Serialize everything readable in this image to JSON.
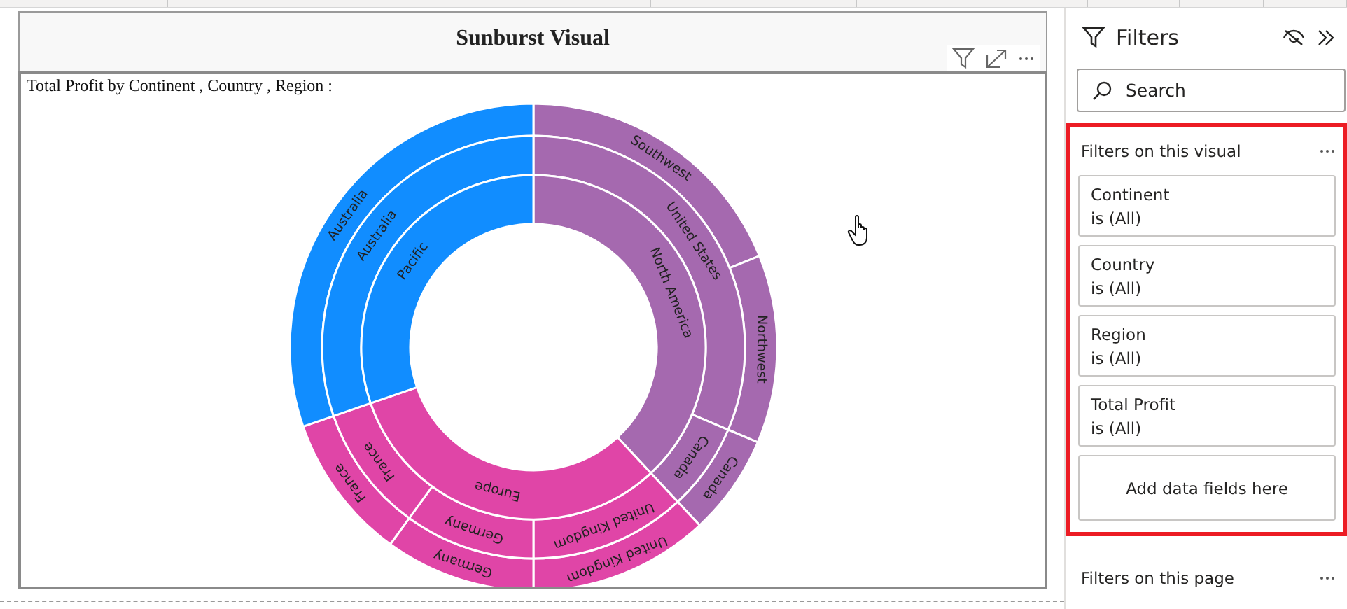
{
  "visual": {
    "title": "Sunburst Visual",
    "subtitle": "Total Profit by Continent , Country , Region :"
  },
  "sunburst": {
    "continents": [
      {
        "label": "North America",
        "color": "#a569af",
        "children": [
          {
            "label": "United States",
            "children": [
              {
                "label": "Southwest"
              },
              {
                "label": "Northwest"
              }
            ]
          },
          {
            "label": "Canada",
            "children": [
              {
                "label": "Canada"
              }
            ]
          }
        ]
      },
      {
        "label": "Europe",
        "color": "#e045a7",
        "children": [
          {
            "label": "United Kingdom",
            "children": [
              {
                "label": "United Kingdom"
              }
            ]
          },
          {
            "label": "Germany",
            "children": [
              {
                "label": "Germany"
              }
            ]
          },
          {
            "label": "France",
            "children": [
              {
                "label": "France"
              }
            ]
          }
        ]
      },
      {
        "label": "Pacific",
        "color": "#118dff",
        "children": [
          {
            "label": "Australia",
            "children": [
              {
                "label": "Australia"
              }
            ]
          }
        ]
      }
    ]
  },
  "filters_pane": {
    "title": "Filters",
    "search": {
      "placeholder": "Search"
    },
    "sections": [
      {
        "title": "Filters on this visual",
        "highlighted": true,
        "cards": [
          {
            "field": "Continent",
            "condition": "is (All)"
          },
          {
            "field": "Country",
            "condition": "is (All)"
          },
          {
            "field": "Region",
            "condition": "is (All)"
          },
          {
            "field": "Total Profit",
            "condition": "is (All)"
          }
        ],
        "drop_hint": "Add data fields here"
      },
      {
        "title": "Filters on this page",
        "highlighted": false
      }
    ]
  }
}
